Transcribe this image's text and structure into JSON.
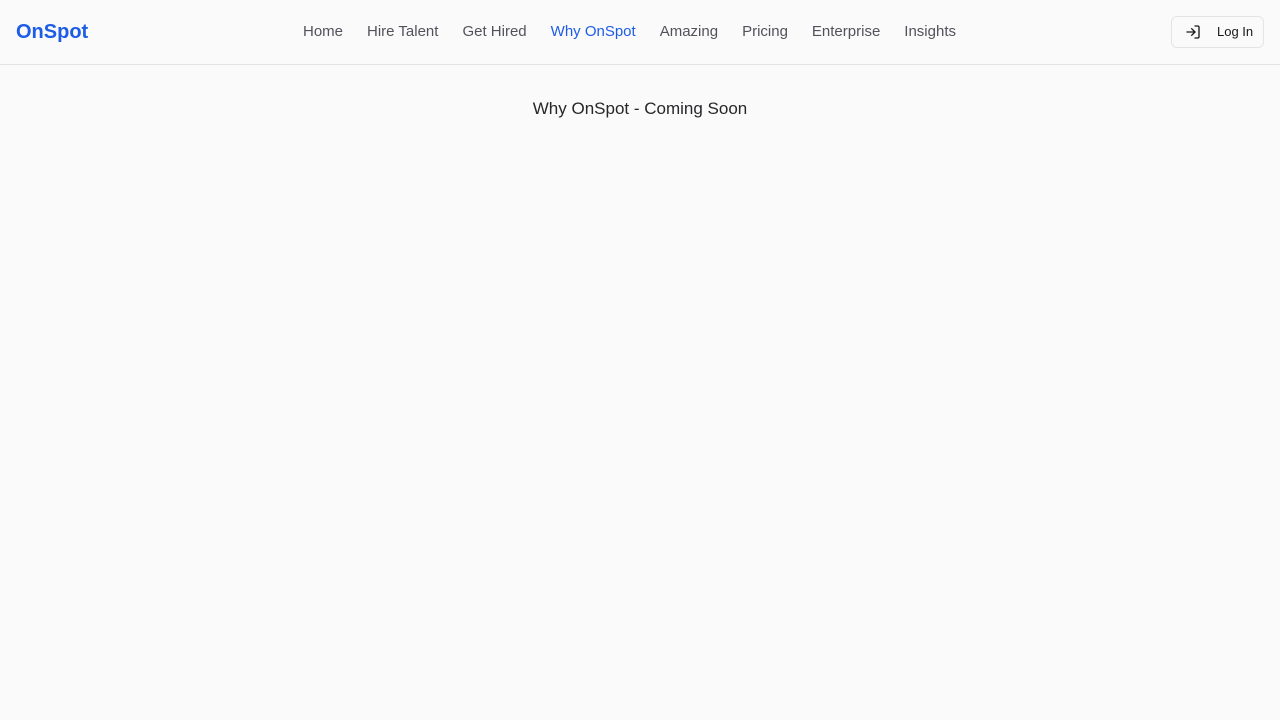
{
  "header": {
    "logo": "OnSpot",
    "nav": [
      {
        "label": "Home"
      },
      {
        "label": "Hire Talent"
      },
      {
        "label": "Get Hired"
      },
      {
        "label": "Why OnSpot",
        "active": true
      },
      {
        "label": "Amazing"
      },
      {
        "label": "Pricing"
      },
      {
        "label": "Enterprise"
      },
      {
        "label": "Insights"
      }
    ],
    "login": {
      "label": "Log In",
      "icon": "log-in-icon"
    }
  },
  "main": {
    "title": "Why OnSpot - Coming Soon"
  },
  "colors": {
    "accent": "#1d5ce6",
    "background": "#fafafa",
    "nav_text": "#52525b",
    "border": "#e4e4e7"
  }
}
